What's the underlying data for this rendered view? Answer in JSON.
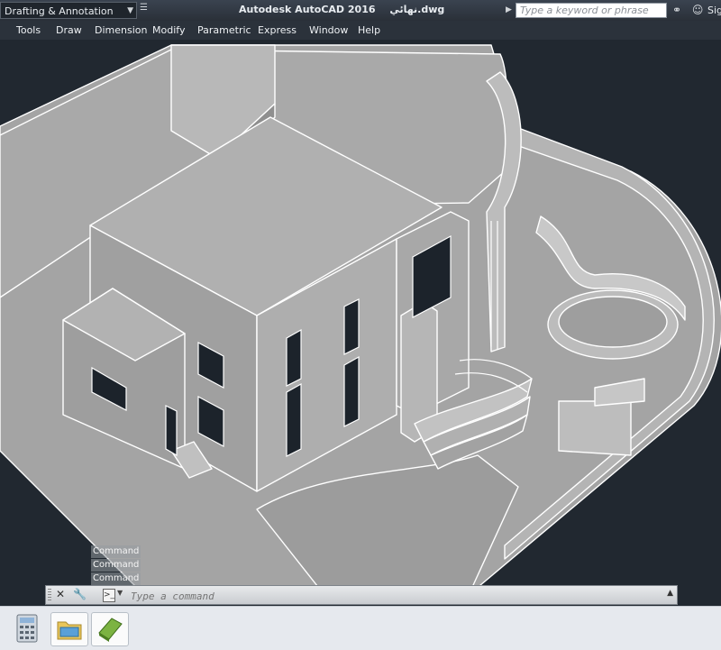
{
  "titlebar": {
    "workspace": "Drafting & Annotation",
    "app_title": "Autodesk AutoCAD 2016",
    "file_name": "نهائي.dwg",
    "search_placeholder": "Type a keyword or phrase",
    "sign_in": "Sig"
  },
  "menu": [
    "Tools",
    "Draw",
    "Dimension",
    "Modify",
    "Parametric",
    "Express",
    "Window",
    "Help"
  ],
  "command": {
    "history": [
      "Command :",
      "Command :",
      "Command :"
    ],
    "placeholder": "Type a command"
  },
  "colors": {
    "model_background": "#212830",
    "model_face": "#a4a4a4",
    "model_edge": "#ffffff",
    "taskbar": "#e6e9ee"
  },
  "taskbar": {
    "icons": [
      "calculator-icon",
      "file-explorer-icon",
      "autocad-app-icon"
    ]
  }
}
